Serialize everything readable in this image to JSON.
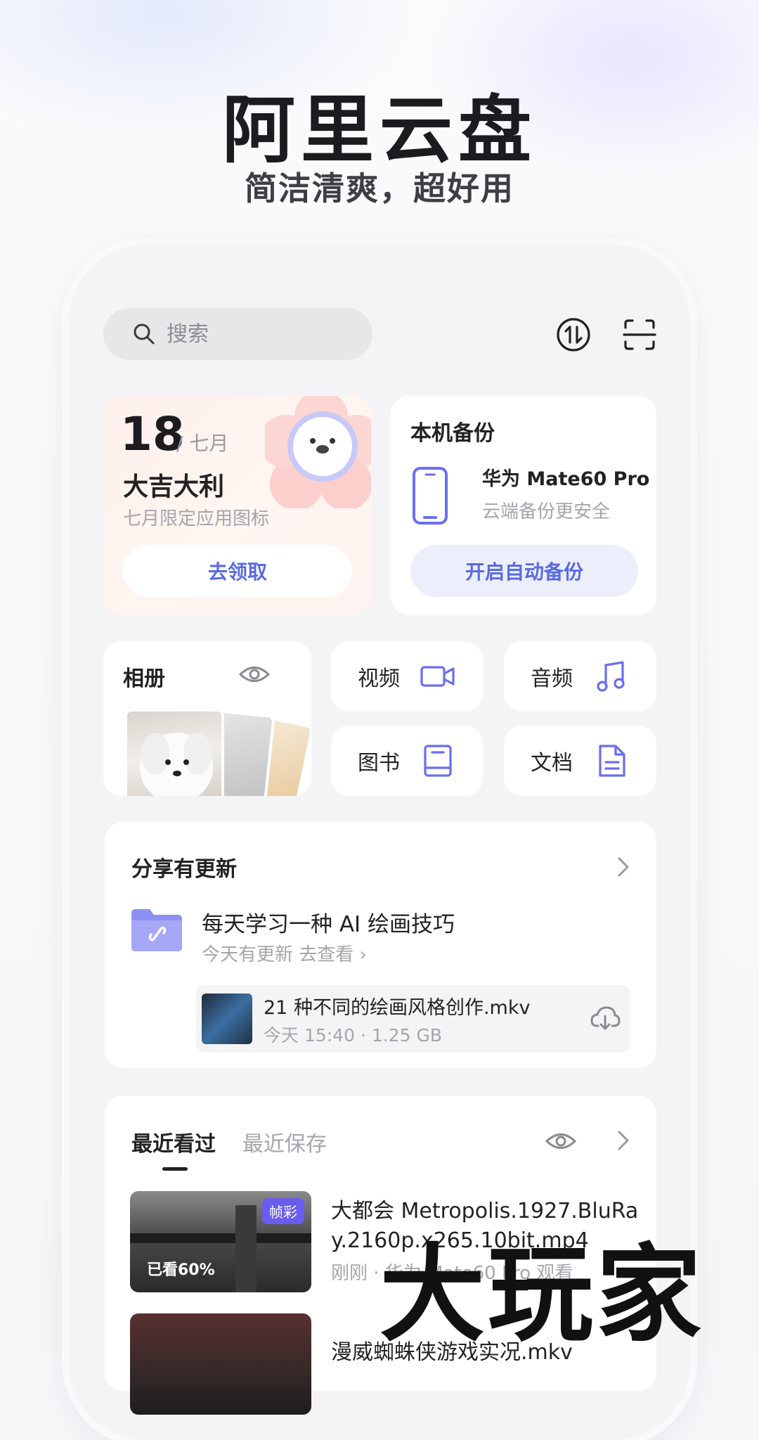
{
  "hero": {
    "title": "阿里云盘",
    "subtitle": "简洁清爽，超好用"
  },
  "search": {
    "placeholder": "搜索"
  },
  "promo": {
    "day": "18",
    "month": "/ 七月",
    "title": "大吉大利",
    "desc": "七月限定应用图标",
    "button": "去领取"
  },
  "backup": {
    "title": "本机备份",
    "device": "华为 Mate60 Pro",
    "desc": "云端备份更安全",
    "button": "开启自动备份"
  },
  "categories": {
    "album": "相册",
    "video": "视频",
    "audio": "音频",
    "book": "图书",
    "doc": "文档"
  },
  "share": {
    "title": "分享有更新",
    "folder_name": "每天学习一种 AI 绘画技巧",
    "meta": "今天有更新   去查看 ›",
    "file_name": "21 种不同的绘画风格创作.mkv",
    "file_meta": "今天 15:40 · 1.25 GB"
  },
  "recent": {
    "tab_active": "最近看过",
    "tab_inactive": "最近保存",
    "items": [
      {
        "title": "大都会 Metropolis.1927.BluRay.2160p.x265.10bit.mp4",
        "meta": "刚刚 · 华为 Mate60 Pro 观看",
        "badge": "帧彩",
        "progress_text": "已看60%"
      },
      {
        "title": "漫威蜘蛛侠游戏实况.mkv"
      }
    ]
  },
  "watermark": "大玩家",
  "colors": {
    "accent": "#5a6be0",
    "accent_light": "#eceefc",
    "badge": "#6b5cf0"
  }
}
